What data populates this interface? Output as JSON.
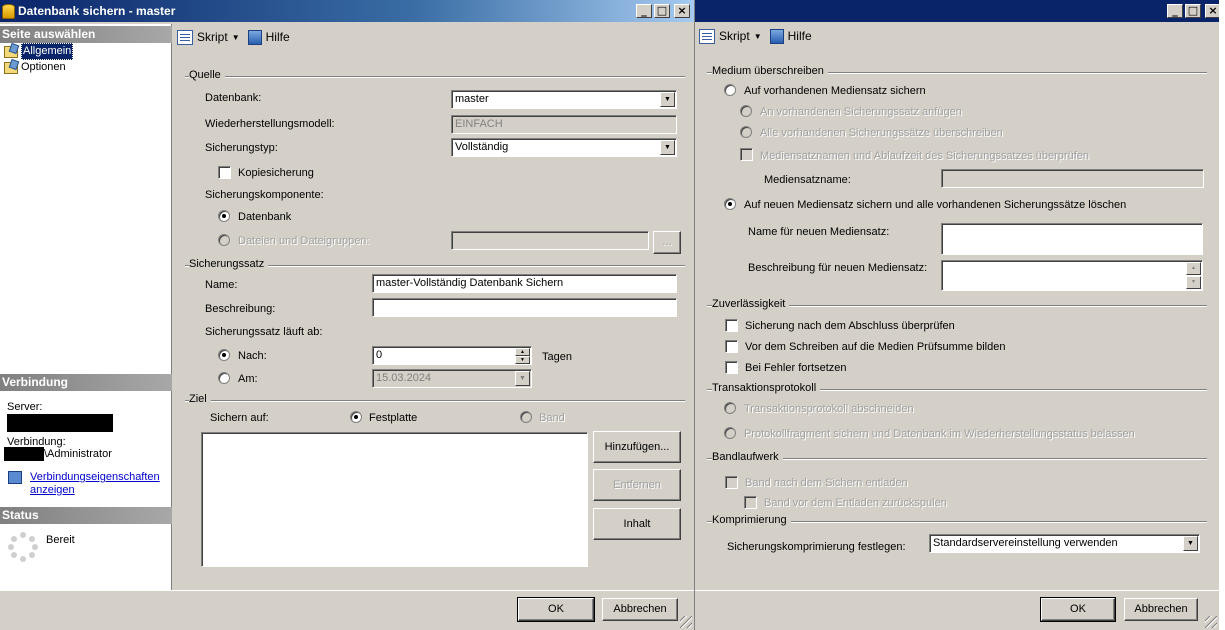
{
  "left_window": {
    "title": "Datenbank sichern - master",
    "caption_buttons": {
      "minimize": "_",
      "maximize": "□",
      "close": "×"
    },
    "select_page": {
      "header": "Seite auswählen",
      "items": [
        {
          "label": "Allgemein"
        },
        {
          "label": "Optionen"
        }
      ]
    },
    "connection": {
      "header": "Verbindung",
      "server_label": "Server:",
      "connection_label": "Verbindung:",
      "user_suffix": "\\Administrator",
      "properties_link": "Verbindungseigenschaften anzeigen"
    },
    "status": {
      "header": "Status",
      "text": "Bereit"
    },
    "toolbar": {
      "script": "Skript",
      "help": "Hilfe"
    },
    "source": {
      "group": "Quelle",
      "database_label": "Datenbank:",
      "database_value": "master",
      "recovery_label": "Wiederherstellungsmodell:",
      "recovery_value": "EINFACH",
      "backup_type_label": "Sicherungstyp:",
      "backup_type_value": "Vollständig",
      "copy_only_label": "Kopiesicherung",
      "component_label": "Sicherungskomponente:",
      "component_database": "Datenbank",
      "component_files": "Dateien und Dateigruppen:",
      "browse": "..."
    },
    "backup_set": {
      "group": "Sicherungssatz",
      "name_label": "Name:",
      "name_value": "master-Vollständig Datenbank Sichern",
      "description_label": "Beschreibung:",
      "description_value": "",
      "expires_label": "Sicherungssatz läuft ab:",
      "after_label": "Nach:",
      "after_value": "0",
      "days_label": "Tagen",
      "on_label": "Am:",
      "on_value": "15.03.2024"
    },
    "destination": {
      "group": "Ziel",
      "backup_to_label": "Sichern auf:",
      "disk_label": "Festplatte",
      "tape_label": "Band",
      "add_button": "Hinzufügen...",
      "remove_button": "Entfernen",
      "contents_button": "Inhalt"
    },
    "footer": {
      "ok": "OK",
      "cancel": "Abbrechen"
    }
  },
  "right_window": {
    "caption_buttons": {
      "minimize": "_",
      "maximize": "□",
      "close": "×"
    },
    "toolbar": {
      "script": "Skript",
      "help": "Hilfe"
    },
    "overwrite": {
      "group": "Medium überschreiben",
      "existing_media": "Auf vorhandenen Mediensatz sichern",
      "append": "An vorhandenen Sicherungssatz anfügen",
      "overwrite_all": "Alle vorhandenen Sicherungssätze überschreiben",
      "check_names": "Mediensatznamen und Ablaufzeit des Sicherungssatzes überprüfen",
      "media_name_label": "Mediensatzname:",
      "new_media": "Auf neuen Mediensatz sichern und alle vorhandenen Sicherungssätze löschen",
      "new_name_label": "Name für neuen Mediensatz:",
      "new_desc_label": "Beschreibung für neuen Mediensatz:"
    },
    "reliability": {
      "group": "Zuverlässigkeit",
      "verify": "Sicherung nach dem Abschluss überprüfen",
      "checksum": "Vor dem Schreiben auf die Medien Prüfsumme bilden",
      "continue_on_error": "Bei Fehler fortsetzen"
    },
    "transaction_log": {
      "group": "Transaktionsprotokoll",
      "truncate": "Transaktionsprotokoll abschneiden",
      "tail": "Protokollfragment sichern und Datenbank im Wiederherstellungsstatus belassen"
    },
    "tape_drive": {
      "group": "Bandlaufwerk",
      "unload": "Band nach dem Sichern entladen",
      "rewind": "Band vor dem Entladen zurückspulen"
    },
    "compression": {
      "group": "Komprimierung",
      "label": "Sicherungskomprimierung festlegen:",
      "value": "Standardservereinstellung verwenden"
    },
    "footer": {
      "ok": "OK",
      "cancel": "Abbrechen"
    }
  }
}
